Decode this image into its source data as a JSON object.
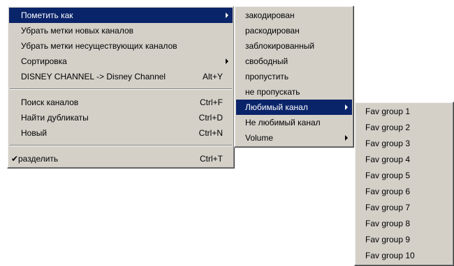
{
  "main_menu": {
    "items": [
      {
        "label": "Пометить как",
        "shortcut": "",
        "submenu": true,
        "selected": true
      },
      {
        "label": "Убрать метки новых каналов",
        "shortcut": ""
      },
      {
        "label": "Убрать метки несуществующих каналов",
        "shortcut": ""
      },
      {
        "label": "Сортировка",
        "shortcut": "",
        "submenu": true
      },
      {
        "label": "DISNEY CHANNEL -> Disney Channel",
        "shortcut": "Alt+Y"
      },
      {
        "label": "Поиск каналов",
        "shortcut": "Ctrl+F"
      },
      {
        "label": "Найти дубликаты",
        "shortcut": "Ctrl+D"
      },
      {
        "label": "Новый",
        "shortcut": "Ctrl+N"
      },
      {
        "label": "разделить",
        "shortcut": "Ctrl+T",
        "checked": true
      }
    ],
    "check_glyph": "✔"
  },
  "mark_submenu": {
    "items": [
      {
        "label": "закодирован"
      },
      {
        "label": "раскодирован"
      },
      {
        "label": "заблокированный"
      },
      {
        "label": "свободный"
      },
      {
        "label": "пропустить"
      },
      {
        "label": "не пропускать"
      },
      {
        "label": "Любимый канал",
        "submenu": true,
        "selected": true
      },
      {
        "label": "Не любимый канал"
      },
      {
        "label": "Volume",
        "submenu": true
      }
    ]
  },
  "fav_submenu": {
    "items": [
      {
        "label": "Fav group 1"
      },
      {
        "label": "Fav group 2"
      },
      {
        "label": "Fav group 3"
      },
      {
        "label": "Fav group 4"
      },
      {
        "label": "Fav group 5"
      },
      {
        "label": "Fav group 6"
      },
      {
        "label": "Fav group 7"
      },
      {
        "label": "Fav group 8"
      },
      {
        "label": "Fav group 9"
      },
      {
        "label": "Fav group 10"
      }
    ]
  },
  "colors": {
    "menu_bg": "#d4d0c8",
    "highlight": "#0a246a",
    "highlight_text": "#ffffff"
  }
}
